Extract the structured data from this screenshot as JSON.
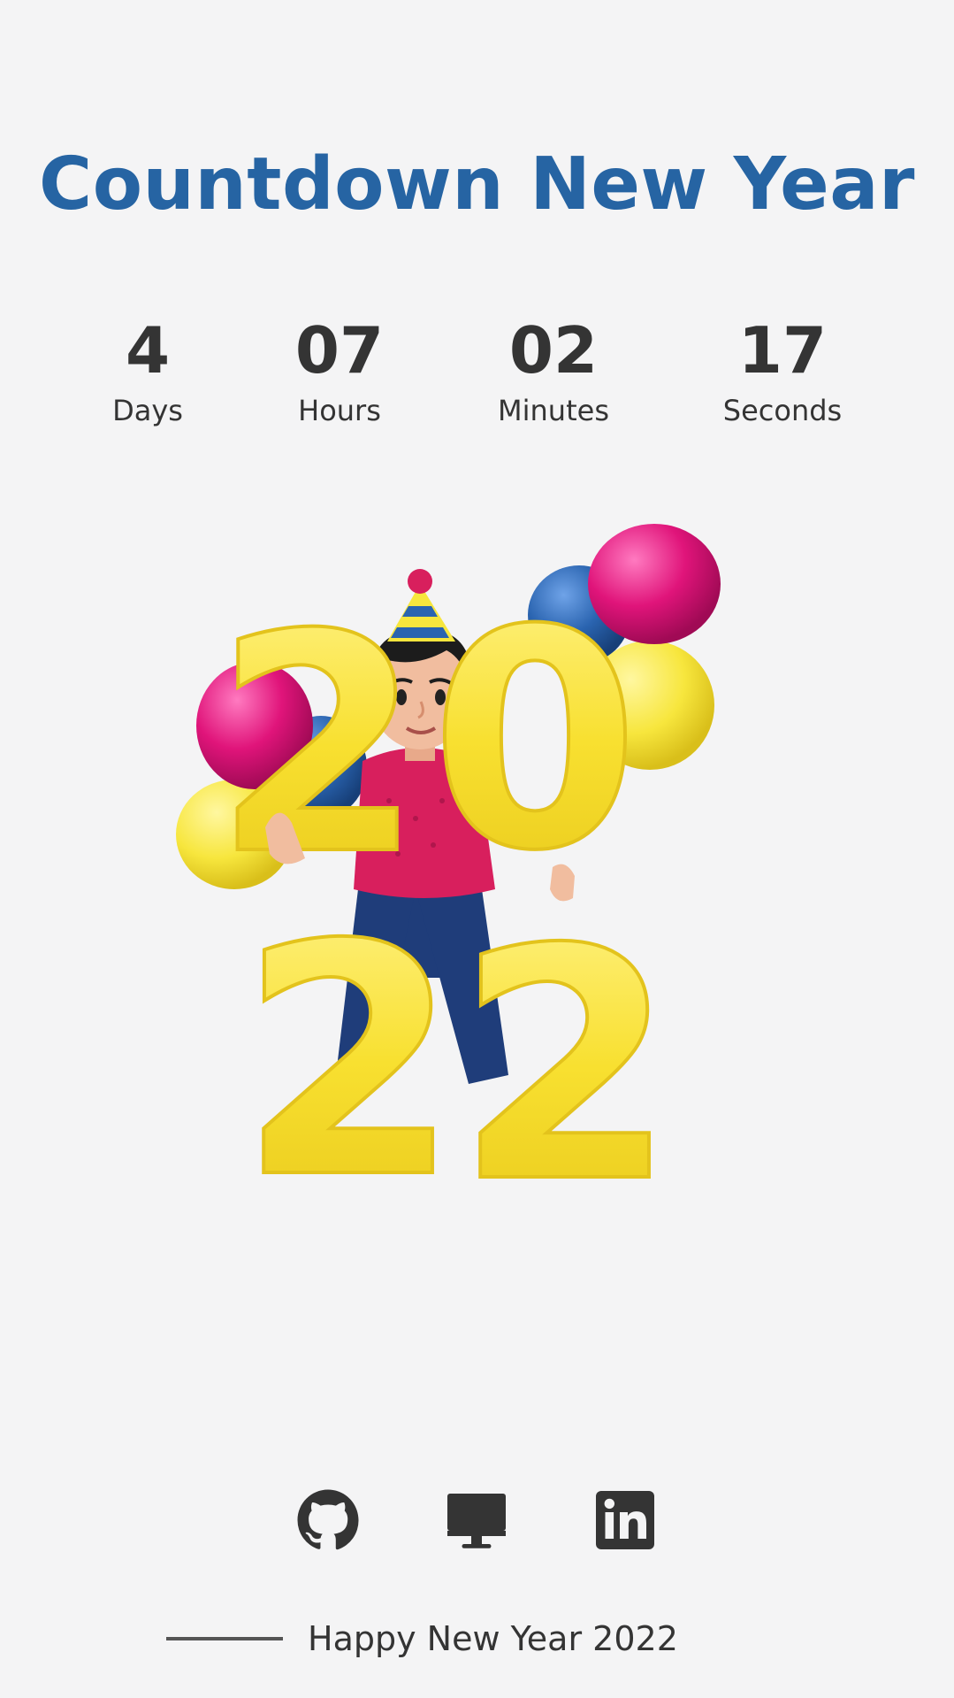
{
  "page": {
    "title": "Countdown New Year"
  },
  "countdown": {
    "units": [
      {
        "value": "4",
        "label": "Days"
      },
      {
        "value": "07",
        "label": "Hours"
      },
      {
        "value": "02",
        "label": "Minutes"
      },
      {
        "value": "17",
        "label": "Seconds"
      }
    ]
  },
  "illustration": {
    "year_digits": [
      "2",
      "0",
      "2",
      "2"
    ],
    "balloon_colors": [
      "#e0147a",
      "#2a64b0",
      "#f7e63d"
    ],
    "digit_color": "#f8e030"
  },
  "social": {
    "icons": [
      "github-icon",
      "desktop-icon",
      "linkedin-icon"
    ]
  },
  "footer": {
    "text": "Happy New Year 2022"
  },
  "colors": {
    "title": "#2664a3",
    "text": "#343434",
    "background": "#f4f4f5"
  }
}
